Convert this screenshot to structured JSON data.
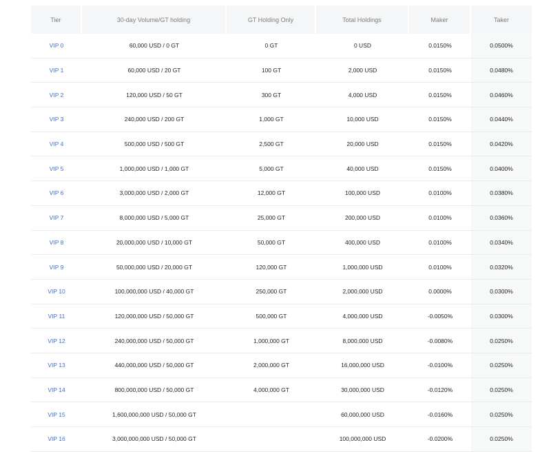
{
  "headers": {
    "tier": "Tier",
    "volume": "30-day Volume/GT holding",
    "gt_only": "GT Holding Only",
    "total": "Total Holdings",
    "maker": "Maker",
    "taker": "Taker"
  },
  "rows": [
    {
      "tier": "VIP 0",
      "volume": "60,000 USD / 0 GT",
      "gt_only": "0 GT",
      "total": "0 USD",
      "maker": "0.0150%",
      "taker": "0.0500%"
    },
    {
      "tier": "VIP 1",
      "volume": "60,000 USD / 20 GT",
      "gt_only": "100 GT",
      "total": "2,000 USD",
      "maker": "0.0150%",
      "taker": "0.0480%"
    },
    {
      "tier": "VIP 2",
      "volume": "120,000 USD / 50 GT",
      "gt_only": "300 GT",
      "total": "4,000 USD",
      "maker": "0.0150%",
      "taker": "0.0460%"
    },
    {
      "tier": "VIP 3",
      "volume": "240,000 USD / 200 GT",
      "gt_only": "1,000 GT",
      "total": "10,000 USD",
      "maker": "0.0150%",
      "taker": "0.0440%"
    },
    {
      "tier": "VIP 4",
      "volume": "500,000 USD / 500 GT",
      "gt_only": "2,500 GT",
      "total": "20,000 USD",
      "maker": "0.0150%",
      "taker": "0.0420%"
    },
    {
      "tier": "VIP 5",
      "volume": "1,000,000 USD / 1,000 GT",
      "gt_only": "5,000 GT",
      "total": "40,000 USD",
      "maker": "0.0150%",
      "taker": "0.0400%"
    },
    {
      "tier": "VIP 6",
      "volume": "3,000,000 USD / 2,000 GT",
      "gt_only": "12,000 GT",
      "total": "100,000 USD",
      "maker": "0.0100%",
      "taker": "0.0380%"
    },
    {
      "tier": "VIP 7",
      "volume": "8,000,000 USD / 5,000 GT",
      "gt_only": "25,000 GT",
      "total": "200,000 USD",
      "maker": "0.0100%",
      "taker": "0.0360%"
    },
    {
      "tier": "VIP 8",
      "volume": "20,000,000 USD / 10,000 GT",
      "gt_only": "50,000 GT",
      "total": "400,000 USD",
      "maker": "0.0100%",
      "taker": "0.0340%"
    },
    {
      "tier": "VIP 9",
      "volume": "50,000,000 USD / 20,000 GT",
      "gt_only": "120,000 GT",
      "total": "1,000,000 USD",
      "maker": "0.0100%",
      "taker": "0.0320%"
    },
    {
      "tier": "VIP 10",
      "volume": "100,000,000 USD / 40,000 GT",
      "gt_only": "250,000 GT",
      "total": "2,000,000 USD",
      "maker": "0.0000%",
      "taker": "0.0300%"
    },
    {
      "tier": "VIP 11",
      "volume": "120,000,000 USD / 50,000 GT",
      "gt_only": "500,000 GT",
      "total": "4,000,000 USD",
      "maker": "-0.0050%",
      "taker": "0.0300%"
    },
    {
      "tier": "VIP 12",
      "volume": "240,000,000 USD / 50,000 GT",
      "gt_only": "1,000,000 GT",
      "total": "8,000,000 USD",
      "maker": "-0.0080%",
      "taker": "0.0250%"
    },
    {
      "tier": "VIP 13",
      "volume": "440,000,000 USD / 50,000 GT",
      "gt_only": "2,000,000 GT",
      "total": "16,000,000 USD",
      "maker": "-0.0100%",
      "taker": "0.0250%"
    },
    {
      "tier": "VIP 14",
      "volume": "800,000,000 USD / 50,000 GT",
      "gt_only": "4,000,000 GT",
      "total": "30,000,000 USD",
      "maker": "-0.0120%",
      "taker": "0.0250%"
    },
    {
      "tier": "VIP 15",
      "volume": "1,600,000,000 USD / 50,000 GT",
      "gt_only": "",
      "total": "60,000,000 USD",
      "maker": "-0.0160%",
      "taker": "0.0250%"
    },
    {
      "tier": "VIP 16",
      "volume": "3,000,000,000 USD / 50,000 GT",
      "gt_only": "",
      "total": "100,000,000 USD",
      "maker": "-0.0200%",
      "taker": "0.0250%"
    }
  ],
  "colors": {
    "tier_link": "#3b6fd1",
    "header_bg": "#f5f6f7",
    "header_text": "#7d7d7d",
    "taker_bg": "#f7f8f8"
  }
}
